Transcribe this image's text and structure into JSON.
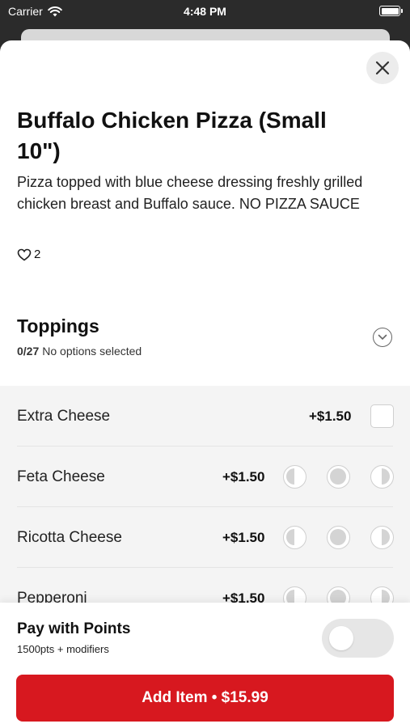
{
  "status_bar": {
    "carrier": "Carrier",
    "time": "4:48 PM"
  },
  "item": {
    "title": "Buffalo Chicken Pizza (Small 10\")",
    "description": "Pizza topped with blue cheese dressing freshly grilled chicken breast and Buffalo sauce. NO PIZZA SAUCE",
    "likes": "2"
  },
  "toppings": {
    "title": "Toppings",
    "count": "0/27",
    "status": "No options selected",
    "options": [
      {
        "name": "Extra Cheese",
        "price": "+$1.50",
        "control": "checkbox"
      },
      {
        "name": "Feta Cheese",
        "price": "+$1.50",
        "control": "portion"
      },
      {
        "name": "Ricotta Cheese",
        "price": "+$1.50",
        "control": "portion"
      },
      {
        "name": "Pepperoni",
        "price": "+$1.50",
        "control": "portion"
      }
    ]
  },
  "points": {
    "title": "Pay with Points",
    "subtitle": "1500pts + modifiers",
    "enabled": false
  },
  "add_button": {
    "label": "Add Item • $15.99"
  },
  "colors": {
    "accent": "#d7181f",
    "options_bg": "#f4f4f4"
  },
  "icons": {
    "close": "close-icon",
    "like": "heart-icon",
    "expand": "chevron-down-icon",
    "wifi": "wifi-icon",
    "battery": "battery-icon"
  }
}
